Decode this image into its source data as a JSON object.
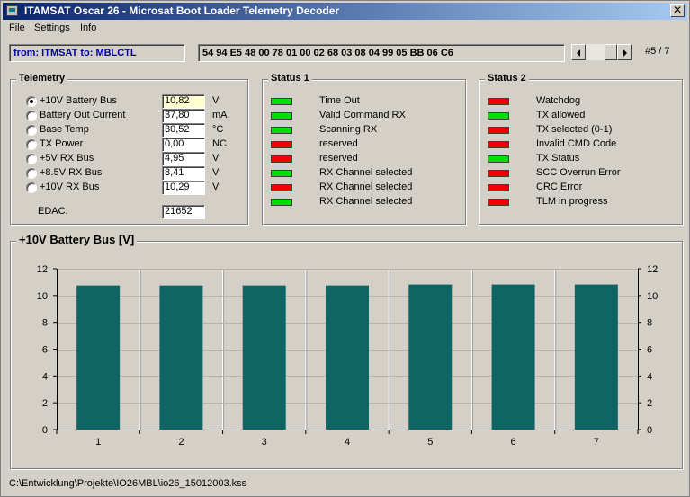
{
  "window": {
    "title": "ITAMSAT Oscar 26 - Microsat Boot Loader Telemetry Decoder",
    "close_label": "✕"
  },
  "menu": [
    "File",
    "Settings",
    "Info"
  ],
  "header": {
    "from_to": "from: ITMSAT to: MBLCTL",
    "hex": "54 94 E5 48 00 78 01 00 02 68 03 08 04 99 05 BB 06 C6",
    "counter": "#5 / 7"
  },
  "telemetry": {
    "title": "Telemetry",
    "rows": [
      {
        "label": "+10V Battery Bus",
        "value": "10,82",
        "unit": "V",
        "selected": true
      },
      {
        "label": "Battery Out Current",
        "value": "37,80",
        "unit": "mA",
        "selected": false
      },
      {
        "label": "Base Temp",
        "value": "30,52",
        "unit": "°C",
        "selected": false
      },
      {
        "label": "TX Power",
        "value": "0,00",
        "unit": "NC",
        "selected": false
      },
      {
        "label": "+5V RX Bus",
        "value": "4,95",
        "unit": "V",
        "selected": false
      },
      {
        "label": "+8.5V RX Bus",
        "value": "8,41",
        "unit": "V",
        "selected": false
      },
      {
        "label": "+10V RX Bus",
        "value": "10,29",
        "unit": "V",
        "selected": false
      }
    ],
    "edac_label": "EDAC:",
    "edac_value": "21652"
  },
  "status1": {
    "title": "Status 1",
    "items": [
      {
        "label": "Time Out",
        "state": "green"
      },
      {
        "label": "Valid Command RX",
        "state": "green"
      },
      {
        "label": "Scanning RX",
        "state": "green"
      },
      {
        "label": "reserved",
        "state": "red"
      },
      {
        "label": "reserved",
        "state": "red"
      },
      {
        "label": "RX Channel selected",
        "state": "green"
      },
      {
        "label": "RX Channel selected",
        "state": "red"
      },
      {
        "label": "RX Channel selected",
        "state": "green"
      }
    ]
  },
  "status2": {
    "title": "Status 2",
    "items": [
      {
        "label": "Watchdog",
        "state": "red"
      },
      {
        "label": "TX allowed",
        "state": "green"
      },
      {
        "label": "TX selected (0-1)",
        "state": "red"
      },
      {
        "label": "Invalid CMD Code",
        "state": "red"
      },
      {
        "label": "TX Status",
        "state": "green"
      },
      {
        "label": "SCC Overrun Error",
        "state": "red"
      },
      {
        "label": "CRC Error",
        "state": "red"
      },
      {
        "label": "TLM in progress",
        "state": "red"
      }
    ]
  },
  "chart_data": {
    "type": "bar",
    "title": "+10V Battery Bus   [V]",
    "categories": [
      "1",
      "2",
      "3",
      "4",
      "5",
      "6",
      "7"
    ],
    "values": [
      10.75,
      10.75,
      10.75,
      10.75,
      10.82,
      10.82,
      10.82
    ],
    "ylim": [
      0,
      12
    ],
    "yticks": [
      0,
      2,
      4,
      6,
      8,
      10,
      12
    ],
    "bar_color": "#0f6464",
    "grid": true,
    "right_axis": true
  },
  "statusbar": {
    "path": "C:\\Entwicklung\\Projekte\\IO26MBL\\io26_15012003.kss"
  },
  "colors": {
    "led_green": "#00e000",
    "led_red": "#f00000",
    "title_from": "#0a246a"
  }
}
